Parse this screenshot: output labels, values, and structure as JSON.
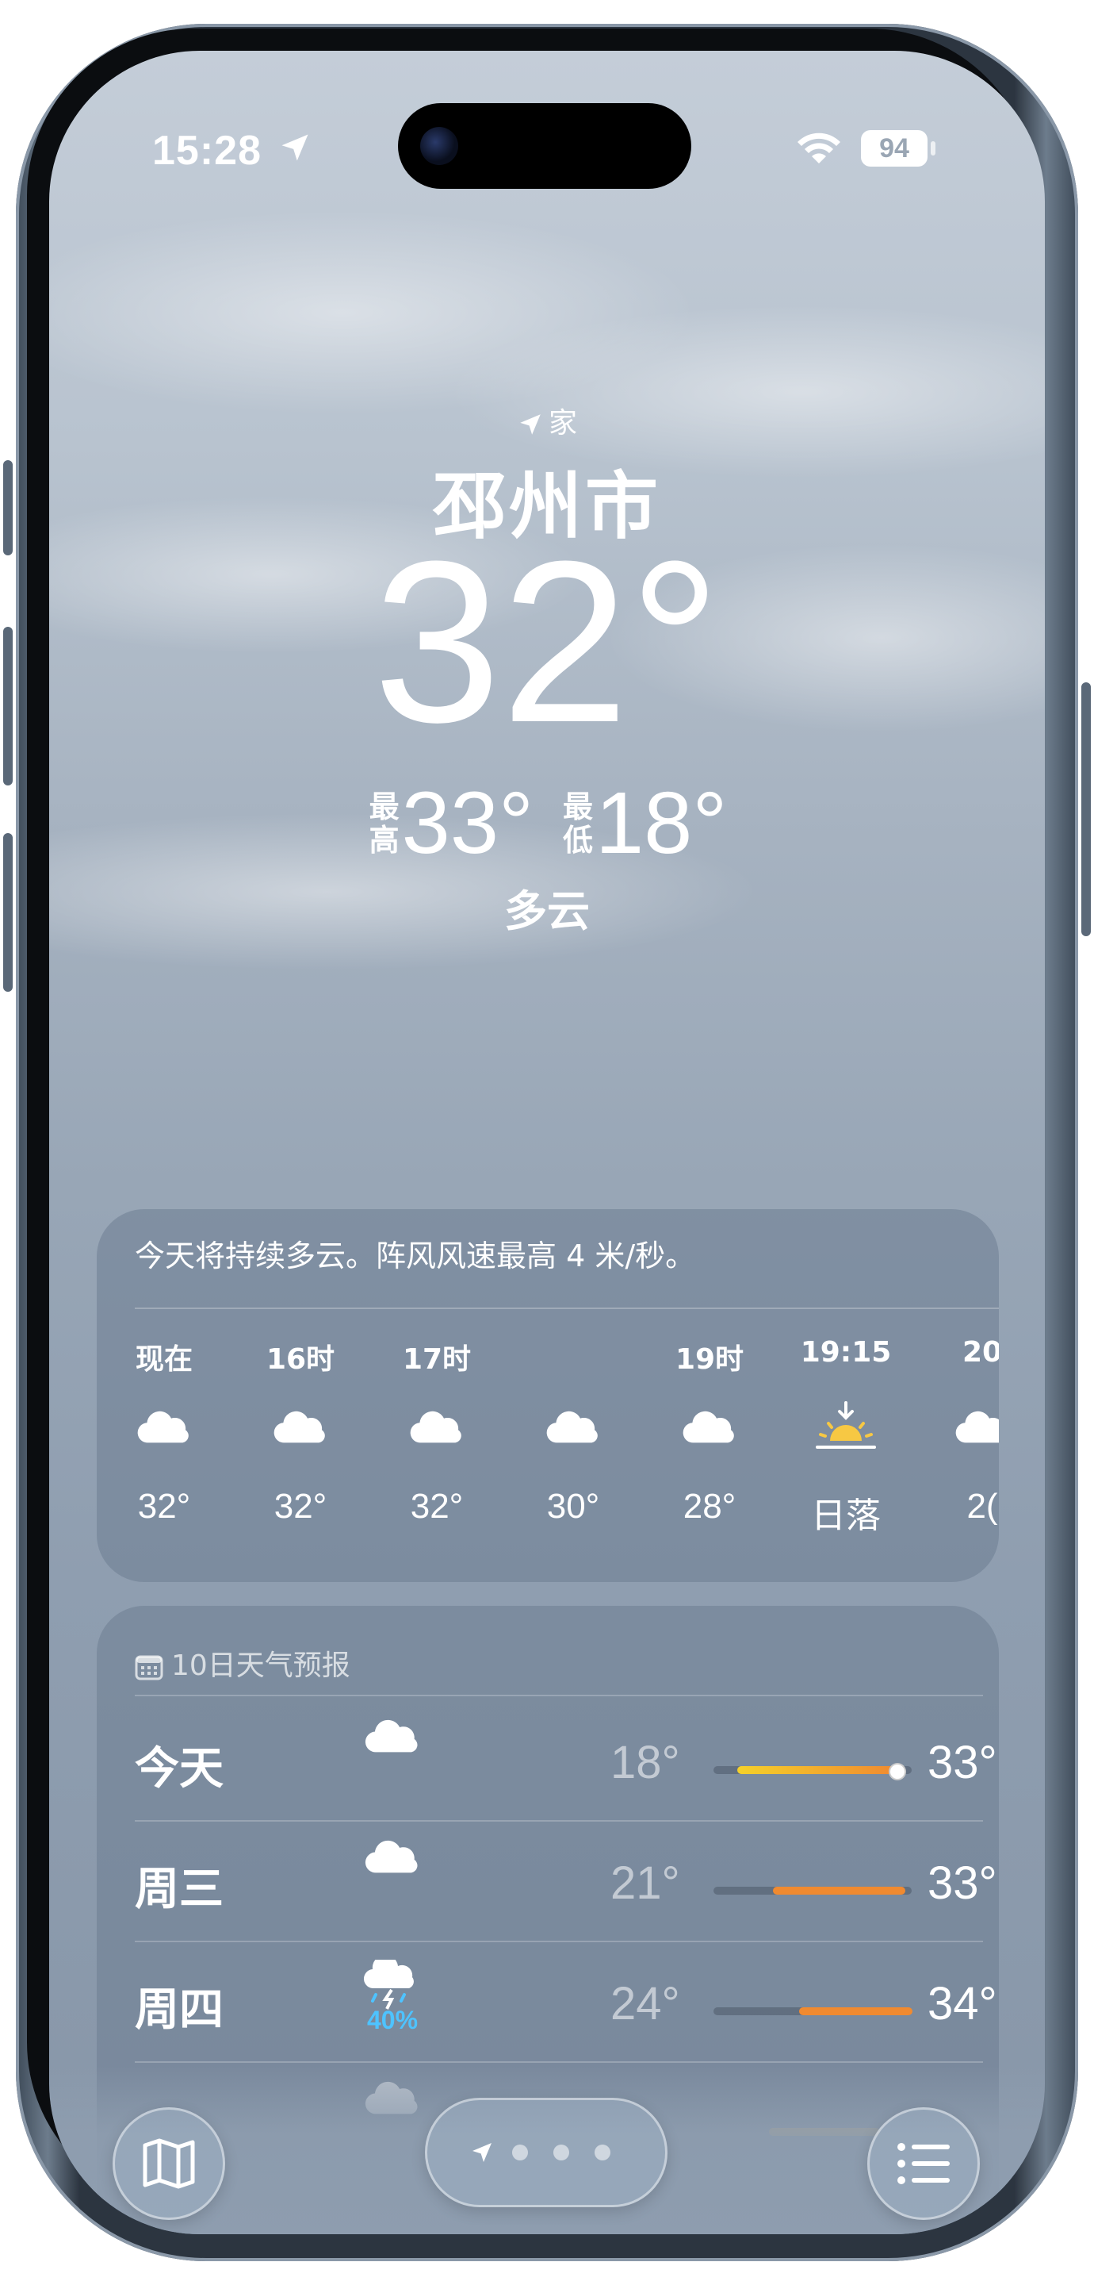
{
  "status_bar": {
    "time": "15:28",
    "battery": "94"
  },
  "location": {
    "home_label": "家",
    "city": "邳州市",
    "temperature": "32°",
    "high_label": "最高",
    "high": "33°",
    "low_label": "最低",
    "low": "18°",
    "condition": "多云"
  },
  "hourly": {
    "summary": "今天将持续多云。阵风风速最高 4 米/秒。",
    "items": [
      {
        "time": "现在",
        "icon": "cloud-icon",
        "temp": "32°"
      },
      {
        "time": "16时",
        "icon": "cloud-icon",
        "temp": "32°"
      },
      {
        "time": "17时",
        "icon": "cloud-icon",
        "temp": "32°"
      },
      {
        "time": "",
        "icon": "cloud-icon",
        "temp": "30°"
      },
      {
        "time": "19时",
        "icon": "cloud-icon",
        "temp": "28°"
      },
      {
        "time": "19:15",
        "icon": "sunset-icon",
        "temp": "日落"
      },
      {
        "time": "20",
        "icon": "cloud-icon",
        "temp": "2("
      }
    ]
  },
  "daily": {
    "header": "10日天气预报",
    "rows": [
      {
        "day": "今天",
        "icon": "cloud-icon",
        "precip": "",
        "low": "18°",
        "high": "33°",
        "bar_start": 0.12,
        "bar_end": 0.92,
        "current": 0.92
      },
      {
        "day": "周三",
        "icon": "cloud-icon",
        "precip": "",
        "low": "21°",
        "high": "33°",
        "bar_start": 0.3,
        "bar_end": 0.97
      },
      {
        "day": "周四",
        "icon": "thunderstorm-icon",
        "precip": "40%",
        "low": "24°",
        "high": "34°",
        "bar_start": 0.43,
        "bar_end": 1.0
      }
    ]
  },
  "colors": {
    "precip": "#4ec3ff",
    "bar_warm": "#f08a30",
    "bar_yellow": "#f5d12a"
  }
}
